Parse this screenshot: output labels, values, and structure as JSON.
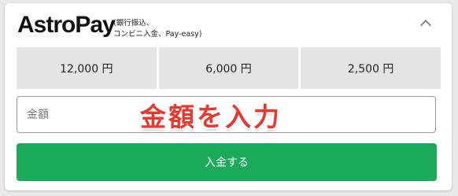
{
  "header": {
    "logo_text": "AstroPay",
    "subtitle_line1": "(銀行振込、",
    "subtitle_line2": "コンビニ入金、Pay-easy)",
    "collapse_icon": "chevron-up-icon"
  },
  "amount_options": [
    {
      "label": "12,000 円"
    },
    {
      "label": "6,000 円"
    },
    {
      "label": "2,500 円"
    }
  ],
  "amount_field": {
    "placeholder": "金額",
    "value": ""
  },
  "annotation": {
    "text": "金額を入力",
    "color": "#e8372c"
  },
  "submit": {
    "label": "入金する",
    "color": "#1aaa5a"
  }
}
